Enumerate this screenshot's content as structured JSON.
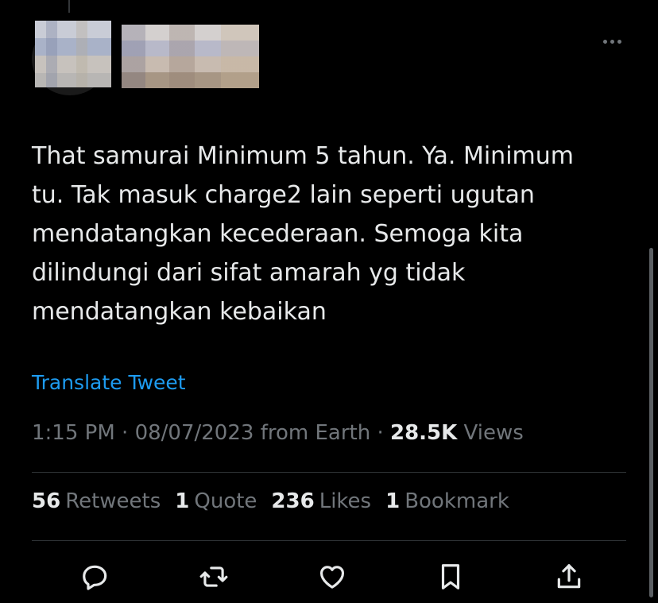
{
  "tweet": {
    "text": "That samurai Minimum 5 tahun. Ya. Minimum\ntu. Tak masuk charge2 lain seperti ugutan\nmendatangkan kecederaan. Semoga kita\ndilindungi dari sifat amarah yg tidak\nmendatangkan kebaikan",
    "translate_label": "Translate Tweet",
    "time": "1:15 PM",
    "date": "08/07/2023",
    "source": "from Earth",
    "sep": "·",
    "views_count": "28.5K",
    "views_label": "Views"
  },
  "stats": [
    {
      "count": "56",
      "label": "Retweets"
    },
    {
      "count": "1",
      "label": "Quote"
    },
    {
      "count": "236",
      "label": "Likes"
    },
    {
      "count": "1",
      "label": "Bookmark"
    }
  ],
  "colors": {
    "background": "#000000",
    "text": "#e7e9ea",
    "muted": "#71767b",
    "link": "#1d9bf0",
    "divider": "#2f3336"
  },
  "icons": {
    "more": "more-horizontal-icon",
    "reply": "reply-icon",
    "retweet": "retweet-icon",
    "like": "heart-icon",
    "bookmark": "bookmark-icon",
    "share": "share-icon"
  }
}
